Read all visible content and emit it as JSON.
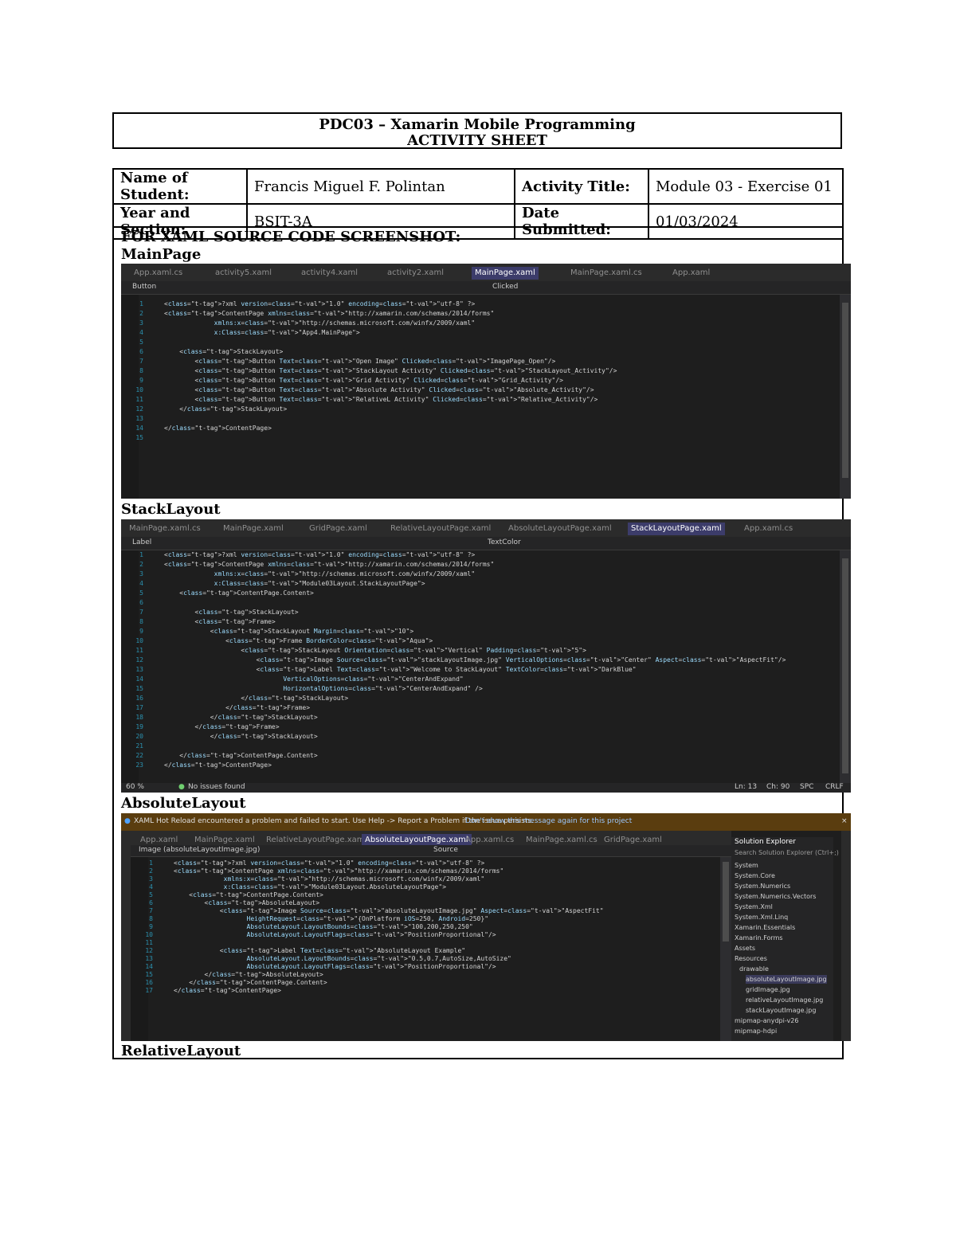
{
  "header": {
    "course": "PDC03 – Xamarin Mobile Programming",
    "sheet": "ACTIVITY SHEET"
  },
  "info": {
    "name_label": "Name of Student:",
    "name_value": "Francis Miguel F. Polintan",
    "activity_label": "Activity Title:",
    "activity_value": "Module 03 - Exercise 01",
    "year_label": "Year and Section:",
    "year_value": "BSIT-3A",
    "date_label": "Date Submitted:",
    "date_value": "01/03/2024"
  },
  "section_heading": "FOR XAML SOURCE CODE SCREENSHOT:",
  "sections": {
    "main": "MainPage",
    "stack": "StackLayout",
    "absolute": "AbsoluteLayout",
    "relative": "RelativeLayout"
  },
  "shot1": {
    "tabs": [
      "App.xaml.cs",
      "activity5.xaml",
      "activity4.xaml",
      "activity2.xaml",
      "MainPage.xaml",
      "MainPage.xaml.cs",
      "App.xaml"
    ],
    "nav_left": "Button",
    "nav_right": "Clicked",
    "lines": [
      "<?xml version=\"1.0\" encoding=\"utf-8\" ?>",
      "<ContentPage xmlns=\"http://xamarin.com/schemas/2014/forms\"",
      "             xmlns:x=\"http://schemas.microsoft.com/winfx/2009/xaml\"",
      "             x:Class=\"App4.MainPage\">",
      "",
      "    <StackLayout>",
      "        <Button Text=\"Open Image\" Clicked=\"ImagePage_Open\"/>",
      "        <Button Text=\"StackLayout Activity\" Clicked=\"StackLayout_Activity\"/>",
      "        <Button Text=\"Grid Activity\" Clicked=\"Grid_Activity\"/>",
      "        <Button Text=\"Absolute Activity\" Clicked=\"Absolute_Activity\"/>",
      "        <Button Text=\"RelativeL Activity\" Clicked=\"Relative_Activity\"/>",
      "    </StackLayout>",
      "",
      "</ContentPage>",
      ""
    ]
  },
  "shot2": {
    "tabs": [
      "MainPage.xaml.cs",
      "MainPage.xaml",
      "GridPage.xaml",
      "RelativeLayoutPage.xaml",
      "AbsoluteLayoutPage.xaml",
      "StackLayoutPage.xaml",
      "App.xaml.cs"
    ],
    "nav_left": "Label",
    "nav_right": "TextColor",
    "lines": [
      "<?xml version=\"1.0\" encoding=\"utf-8\" ?>",
      "<ContentPage xmlns=\"http://xamarin.com/schemas/2014/forms\"",
      "             xmlns:x=\"http://schemas.microsoft.com/winfx/2009/xaml\"",
      "             x:Class=\"Module03Layout.StackLayoutPage\">",
      "    <ContentPage.Content>",
      "",
      "        <StackLayout>",
      "        <Frame>",
      "            <StackLayout Margin=\"10\">",
      "                <Frame BorderColor=\"Aqua\">",
      "                    <StackLayout Orientation=\"Vertical\" Padding=\"5\">",
      "                        <Image Source=\"stackLayoutImage.jpg\" VerticalOptions=\"Center\" Aspect=\"AspectFit\"/>",
      "                        <Label Text=\"Welcome to StackLayout\" TextColor=\"DarkBlue\"",
      "                               VerticalOptions=\"CenterAndExpand\"",
      "                               HorizontalOptions=\"CenterAndExpand\" />",
      "                    </StackLayout>",
      "                </Frame>",
      "            </StackLayout>",
      "        </Frame>",
      "            </StackLayout>",
      "",
      "    </ContentPage.Content>",
      "</ContentPage>"
    ],
    "status": [
      "60 %",
      "No issues found",
      "Ln: 13",
      "Ch: 90",
      "SPC",
      "CRLF"
    ]
  },
  "shot3": {
    "infobar": "XAML Hot Reload encountered a problem and failed to start. Use Help -> Report a Problem if the issue persists.",
    "infobar_link": "Don't show this message again for this project",
    "tabs": [
      "App.xaml",
      "MainPage.xaml",
      "RelativeLayoutPage.xaml",
      "AbsoluteLayoutPage.xaml",
      "App.xaml.cs",
      "MainPage.xaml.cs",
      "GridPage.xaml"
    ],
    "nav_left": "Image (absoluteLayoutImage.jpg)",
    "nav_right": "Source",
    "lines": [
      "<?xml version=\"1.0\" encoding=\"utf-8\" ?>",
      "<ContentPage xmlns=\"http://xamarin.com/schemas/2014/forms\"",
      "             xmlns:x=\"http://schemas.microsoft.com/winfx/2009/xaml\"",
      "             x:Class=\"Module03Layout.AbsoluteLayoutPage\">",
      "    <ContentPage.Content>",
      "        <AbsoluteLayout>",
      "            <Image Source=\"absoluteLayoutImage.jpg\" Aspect=\"AspectFit\"",
      "                   HeightRequest=\"{OnPlatform iOS=250, Android=250}\"",
      "                   AbsoluteLayout.LayoutBounds=\"100,200,250,250\"",
      "                   AbsoluteLayout.LayoutFlags=\"PositionProportional\"/>",
      "",
      "            <Label Text=\"AbsoluteLayout Example\"",
      "                   AbsoluteLayout.LayoutBounds=\"0.5,0.7,AutoSize,AutoSize\"",
      "                   AbsoluteLayout.LayoutFlags=\"PositionProportional\"/>",
      "        </AbsoluteLayout>",
      "    </ContentPage.Content>",
      "</ContentPage>"
    ],
    "solution_title": "Solution Explorer",
    "solution_search": "Search Solution Explorer (Ctrl+;)",
    "solution_items": [
      "System",
      "System.Core",
      "System.Numerics",
      "System.Numerics.Vectors",
      "System.Xml",
      "System.Xml.Linq",
      "Xamarin.Essentials",
      "Xamarin.Forms",
      "Assets",
      "Resources",
      "drawable",
      "absoluteLayoutImage.jpg",
      "gridImage.jpg",
      "relativeLayoutImage.jpg",
      "stackLayoutImage.jpg",
      "mipmap-anydpi-v26",
      "mipmap-hdpi"
    ]
  }
}
